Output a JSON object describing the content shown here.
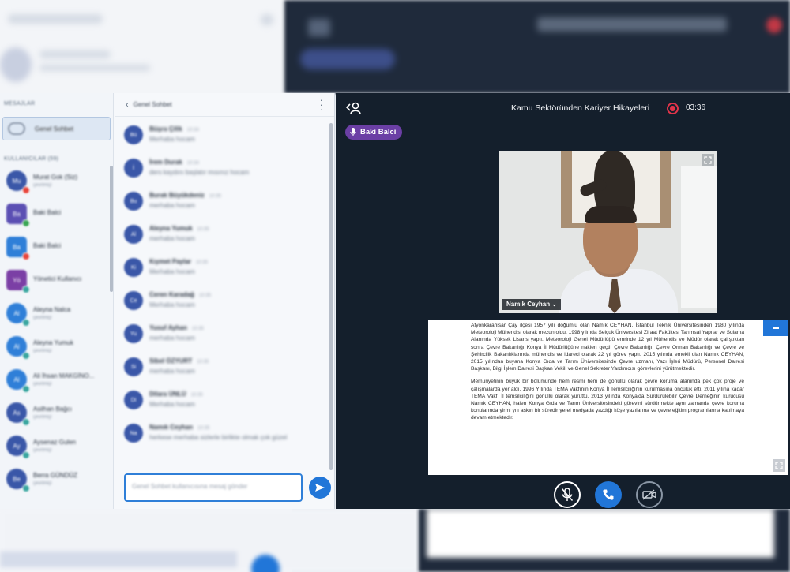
{
  "chat": {
    "messages_section": "MESAJLAR",
    "group_chat_label": "Genel Sohbet",
    "users_section": "KULLANICILAR (59)",
    "users": [
      {
        "initials": "Mu",
        "name": "Murat Gok (Siz)",
        "status": "çevrimiçi",
        "color": "#3a57a8",
        "dot": "#e8453c",
        "round": true
      },
      {
        "initials": "Ba",
        "name": "Baki Balci",
        "status": "",
        "color": "#5b4fb3",
        "dot": "#3aa655",
        "round": false
      },
      {
        "initials": "Ba",
        "name": "Baki Balci",
        "status": "",
        "color": "#2f7fd8",
        "dot": "#e8453c",
        "round": false
      },
      {
        "initials": "Yö",
        "name": "Yönetici Kullanıcı",
        "status": "",
        "color": "#7b3fa5",
        "dot": "#3aa6a0",
        "round": false
      },
      {
        "initials": "Al",
        "name": "Aleyna Nalca",
        "status": "çevrimiçi",
        "color": "#2f7fd8",
        "dot": "#3aa6a0",
        "round": true
      },
      {
        "initials": "Al",
        "name": "Aleyna Yumuk",
        "status": "çevrimiçi",
        "color": "#2f7fd8",
        "dot": "#3aa6a0",
        "round": true
      },
      {
        "initials": "Al",
        "name": "Ali İhsan MAKGİNO...",
        "status": "çevrimiçi",
        "color": "#2f7fd8",
        "dot": "#3aa6a0",
        "round": true
      },
      {
        "initials": "As",
        "name": "Asilhan Bağcı",
        "status": "çevrimiçi",
        "color": "#3a57a8",
        "dot": "#3aa6a0",
        "round": true
      },
      {
        "initials": "Ay",
        "name": "Aysenaz Gulen",
        "status": "çevrimiçi",
        "color": "#3a57a8",
        "dot": "#3aa6a0",
        "round": true
      },
      {
        "initials": "Be",
        "name": "Berra GÜNDÜZ",
        "status": "çevrimiçi",
        "color": "#3a57a8",
        "dot": "#3aa6a0",
        "round": true
      }
    ],
    "header_back": "‹",
    "header_title": "Genel Sohbet",
    "messages": [
      {
        "initials": "Bü",
        "name": "Büşra Çilik",
        "time": "10:34",
        "text": "Merhaba hocam"
      },
      {
        "initials": "İ",
        "name": "İrem Durak",
        "time": "10:34",
        "text": "ders kaydını başlatır mısınız hocam"
      },
      {
        "initials": "Bu",
        "name": "Burak Büyükdeniz",
        "time": "10:35",
        "text": "merhaba hocam"
      },
      {
        "initials": "Al",
        "name": "Aleyna Yumuk",
        "time": "10:35",
        "text": "merhaba hocam"
      },
      {
        "initials": "Ki",
        "name": "Kıymet Paylar",
        "time": "10:35",
        "text": "Merhaba hocam"
      },
      {
        "initials": "Ce",
        "name": "Ceren Karadağ",
        "time": "10:35",
        "text": "Merhaba hocam"
      },
      {
        "initials": "Yu",
        "name": "Yusuf Ayhan",
        "time": "10:35",
        "text": "merhaba hocam"
      },
      {
        "initials": "Si",
        "name": "Sibel ÖZYURT",
        "time": "10:35",
        "text": "merhaba hocam"
      },
      {
        "initials": "Di",
        "name": "Dilara ÜNLÜ",
        "time": "10:35",
        "text": "Merhaba hocam"
      },
      {
        "initials": "Na",
        "name": "Namık Ceyhan",
        "time": "10:35",
        "text": "herkese merhaba sizlerle birlikte olmak çok güzel"
      }
    ],
    "input_placeholder": "Genel Sohbet kullanıcısına mesaj gönder"
  },
  "presentation": {
    "title": "Kamu Sektöründen Kariyer Hikayeleri",
    "recording_time": "03:36",
    "presenter_name": "Baki Balci",
    "webcam_name": "Namık Ceyhan ⌄",
    "doc_paragraphs": [
      "Afyonkarahisar Çay ilçesi 1957 yılı doğumlu olan Namık CEYHAN, İstanbul Teknik Üniversitesinden 1980 yılında Meteoroloji Mühendisi olarak mezun oldu. 1998 yılında Selçuk Üniversitesi Ziraat Fakültesi Tarımsal Yapılar ve Sulama Alanında Yüksek Lisans yaptı. Meteoroloji Genel Müdürlüğü emrinde 12 yıl Mühendis ve Müdür olarak çalıştıktan sonra Çevre Bakanlığı Konya İl Müdürlüğüne naklen geçti. Çevre Bakanlığı, Çevre Orman Bakanlığı ve Çevre ve Şehircilik Bakanlıklarında mühendis ve idareci olarak 22 yıl görev yaptı. 2015 yılında emekli olan Namık CEYHAN, 2015 yılından buyana Konya Gıda ve Tarım Üniversitesinde Çevre uzmanı, Yazı İşleri Müdürü, Personel Dairesi Başkanı, Bilgi İşlem Dairesi Başkan Vekili ve Genel Sekreter Yardımcısı görevlerini yürütmektedir.",
      "Memuriyetinin büyük bir bölümünde hem resmi hem de gönüllü olarak çevre koruma alanında pek çok proje ve çalışmalarda yer aldı. 1996 Yılında TEMA Vakfının Konya İl Temsilciliğinin kurulmasına öncülük etti. 2011 yılına kadar TEMA Vakfı İl temsilciliğini gönüllü olarak yürüttü. 2013 yılında Konya'da Sürdürülebilir Çevre Derneğinin kurucusu Namık CEYHAN, halen Konya Gıda ve Tarım Üniversitesindeki görevini sürdürmekte aynı zamanda çevre koruma konularında yirmi yılı aşkın bir süredir yerel medyada yazdığı köşe yazılarına ve çevre eğitim programlarına katılmaya devam etmektedir."
    ]
  },
  "colors": {
    "accent": "#2176d8",
    "presenter_badge": "#6b3fa5",
    "record": "#e2344a",
    "pres_bg": "#141f2c"
  }
}
